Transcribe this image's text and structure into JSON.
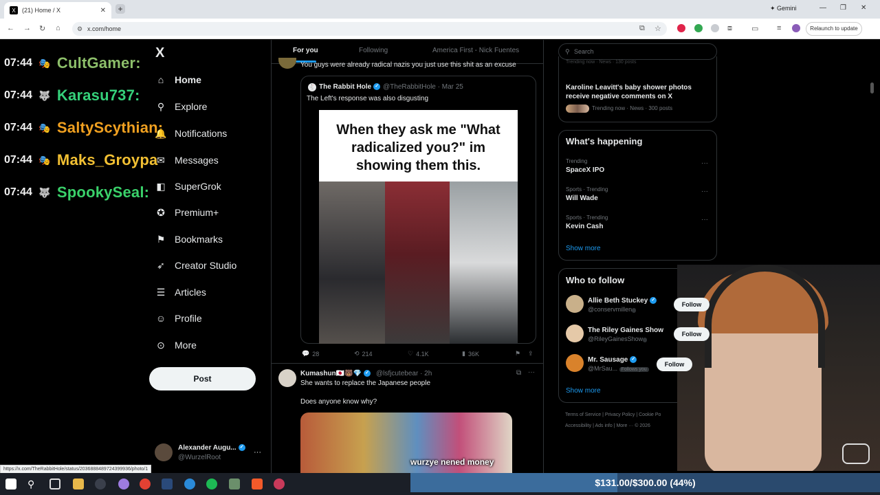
{
  "browser": {
    "tab_title": "(21) Home / X",
    "tab_favicon": "X",
    "gemini_label": "Gemini",
    "url": "x.com/home",
    "relaunch_label": "Relaunch to update",
    "status_url": "https://x.com/TheRabbitHole/status/2036888489724399936/photo/1"
  },
  "chat": [
    {
      "time": "07:44",
      "user": "CultGamer:",
      "color": "#8dbf6a",
      "badge": "🎭"
    },
    {
      "time": "07:44",
      "user": "Karasu737:",
      "color": "#35d07a",
      "badge": "🐺"
    },
    {
      "time": "07:44",
      "user": "SaltyScythian:",
      "color": "#f0a020",
      "badge": "🎭"
    },
    {
      "time": "07:44",
      "user": "Maks_Groypa",
      "color": "#f2c033",
      "badge": "🎭"
    },
    {
      "time": "07:44",
      "user": "SpookySeal:",
      "color": "#3ad16a",
      "badge": "🐺"
    }
  ],
  "nav": {
    "logo": "X",
    "items": [
      {
        "label": "Home",
        "icon": "home-icon"
      },
      {
        "label": "Explore",
        "icon": "search-icon"
      },
      {
        "label": "Notifications",
        "icon": "bell-icon"
      },
      {
        "label": "Messages",
        "icon": "mail-icon"
      },
      {
        "label": "SuperGrok",
        "icon": "grok-icon"
      },
      {
        "label": "Premium+",
        "icon": "premium-icon"
      },
      {
        "label": "Bookmarks",
        "icon": "bookmark-icon"
      },
      {
        "label": "Creator Studio",
        "icon": "rocket-icon"
      },
      {
        "label": "Articles",
        "icon": "article-icon"
      },
      {
        "label": "Profile",
        "icon": "person-icon"
      },
      {
        "label": "More",
        "icon": "more-icon"
      }
    ],
    "post_label": "Post",
    "account_name": "Alexander Augu...",
    "account_handle": "@WurzelRoot"
  },
  "feed": {
    "tabs": [
      "For you",
      "Following",
      "America First - Nick Fuentes"
    ],
    "tweet1_text": "You guys were already radical nazis you just use this shit as an excuse",
    "quote_author": "The Rabbit Hole",
    "quote_handle": "@TheRabbitHole · Mar 25",
    "quote_text": "The Left's response was also disgusting",
    "meme_line1": "When they ask me \"What",
    "meme_line2": "radicalized you?\" im",
    "meme_line3": "showing them this.",
    "replies": "28",
    "reposts": "214",
    "likes": "4.1K",
    "views": "36K",
    "tweet2_author": "Kumashun🇯🇵🐻💎",
    "tweet2_handle": "@lsfjcutebear · 2h",
    "tweet2_text": "She wants to replace the Japanese people",
    "tweet2_subtext": "Does anyone know why?"
  },
  "right": {
    "search_placeholder": "Search",
    "top_trend_partial": "Trending now · News · 130 posts",
    "news_title": "Karoline Leavitt's baby shower photos receive negative comments on X",
    "news_meta": "Trending now · News · 300 posts",
    "happening_title": "What's happening",
    "trends": [
      {
        "cat": "Trending",
        "name": "SpaceX IPO"
      },
      {
        "cat": "Sports · Trending",
        "name": "Will Wade"
      },
      {
        "cat": "Sports · Trending",
        "name": "Kevin Cash"
      }
    ],
    "show_more": "Show more",
    "wtf_title": "Who to follow",
    "wtf": [
      {
        "name": "Allie Beth Stuckey",
        "handle": "@conservmillen",
        "follows_you": ""
      },
      {
        "name": "The Riley Gaines Show",
        "handle": "@RileyGainesShow",
        "follows_you": ""
      },
      {
        "name": "Mr. Sausage",
        "handle": "@MrSau...",
        "follows_you": "Follows you"
      }
    ],
    "follow_label": "Follow",
    "footer1": "Terms of Service  |  Privacy Policy  |  Cookie Po",
    "footer2": "Accessibility  |  Ads info  |  More ···  © 2026"
  },
  "stream": {
    "caption": "wurzye nened money",
    "goal_text": "$131.00/$300.00 (44%)",
    "goal_progress": 0.44
  }
}
